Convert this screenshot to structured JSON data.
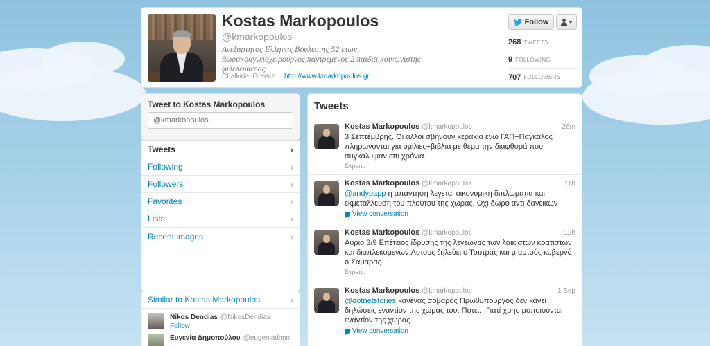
{
  "profile": {
    "name": "Kostas Markopoulos",
    "handle": "@kmarkopoulos",
    "bio": "Ανεξαρτητος Ελληνας Βουλευτης 52 ετων, θωρακοαγγειοχειρουργος,παντρεμενος,2 παιδια,κοινωνιστης φιλελευθερος",
    "location": "Chalkida, Greece",
    "url": "http://www.kmarkopoulos.gr",
    "follow_label": "Follow",
    "stats": [
      {
        "count": "268",
        "label": "TWEETS"
      },
      {
        "count": "9",
        "label": "FOLLOWING"
      },
      {
        "count": "707",
        "label": "FOLLOWERS"
      }
    ]
  },
  "tweet_to": {
    "title": "Tweet to Kostas Markopoulos",
    "placeholder": "@kmarkopoulos"
  },
  "nav": {
    "items": [
      {
        "label": "Tweets"
      },
      {
        "label": "Following"
      },
      {
        "label": "Followers"
      },
      {
        "label": "Favorites"
      },
      {
        "label": "Lists"
      },
      {
        "label": "Recent images"
      }
    ]
  },
  "similar": {
    "title": "Similar to Kostas Markopoulos",
    "users": [
      {
        "name": "Nikos Dendias",
        "handle": "@NikosDendias",
        "follow": "Follow"
      },
      {
        "name": "Ευγενία Δημοπούλου",
        "handle": "@eugeniadimo",
        "follow": ""
      }
    ]
  },
  "tweets": {
    "title": "Tweets",
    "items": [
      {
        "name": "Kostas Markopoulos",
        "handle": "@kmarkopoulos",
        "time": "26m",
        "mention": "",
        "text": "3 Σεπτέμβρης. Οι άλλοι σβήνουν κεράκια ενω ΓΑΠ+Παγκαλος πληρωνονται για ομιλιες+βιβλια με θεμα την διαφθορά που συγκαλυψαν επι χρόνια.",
        "action": "Expand"
      },
      {
        "name": "Kostas Markopoulos",
        "handle": "@kmarkopoulos",
        "time": "11h",
        "mention": "@andypapp",
        "text": " η απαντηση λεγεται οικονομικη διπλωματια και εκμεταλλευση του πλουτου της χωρας. Οχι δωρο αντι δανεικων",
        "action": "View conversation"
      },
      {
        "name": "Kostas Markopoulos",
        "handle": "@kmarkopoulos",
        "time": "12h",
        "mention": "",
        "text": "Αύριο 3/9 Επέτειος ίδρυσης της λεγεωνας των λαικιστων κρατιστων και διαπλεκομενων.Αυτους ζηλεύει ο Τσιπρας και μ αυτούς κυβερνά ο Σαμαρας",
        "action": "Expand"
      },
      {
        "name": "Kostas Markopoulos",
        "handle": "@kmarkopoulos",
        "time": "1 Sep",
        "mention": "@dotnetstories",
        "text": " κανένας σοβαρός Πρωθυπουργός δεν κάνει δηλώσεις εναντίον της χώρας του. Ποτε....Γιατί χρησιμοποιούνται εναντίον της χώρας",
        "action": "View conversation"
      }
    ]
  }
}
